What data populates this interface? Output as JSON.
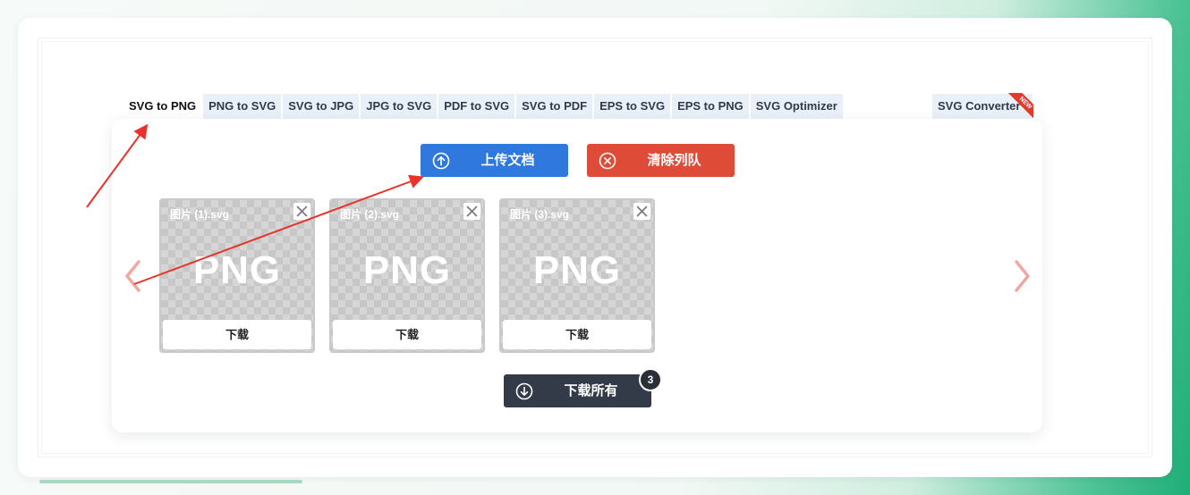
{
  "tabs": [
    {
      "label": "SVG to PNG"
    },
    {
      "label": "PNG to SVG"
    },
    {
      "label": "SVG to JPG"
    },
    {
      "label": "JPG to SVG"
    },
    {
      "label": "PDF to SVG"
    },
    {
      "label": "SVG to PDF"
    },
    {
      "label": "EPS to SVG"
    },
    {
      "label": "EPS to PNG"
    },
    {
      "label": "SVG Optimizer"
    }
  ],
  "tab_converter": {
    "label": "SVG Converter",
    "ribbon": "NEW"
  },
  "actions": {
    "upload_label": "上传文档",
    "clear_label": "清除列队"
  },
  "files": [
    {
      "name": "图片 (1).svg",
      "preview": "PNG",
      "download_label": "下载"
    },
    {
      "name": "图片 (2).svg",
      "preview": "PNG",
      "download_label": "下载"
    },
    {
      "name": "图片 (3).svg",
      "preview": "PNG",
      "download_label": "下载"
    }
  ],
  "download_all": {
    "label": "下载所有",
    "count": "3"
  },
  "colors": {
    "upload": "#2f78de",
    "clear": "#de4c38",
    "download_all": "#323b47",
    "annotation_arrow": "#e8322a",
    "nav_arrow": "#f0a8a0"
  },
  "icons": {
    "upload": "arrow-up-circle-icon",
    "clear": "x-circle-icon",
    "download_all": "arrow-down-circle-icon",
    "prev": "chevron-left-icon",
    "next": "chevron-right-icon"
  }
}
